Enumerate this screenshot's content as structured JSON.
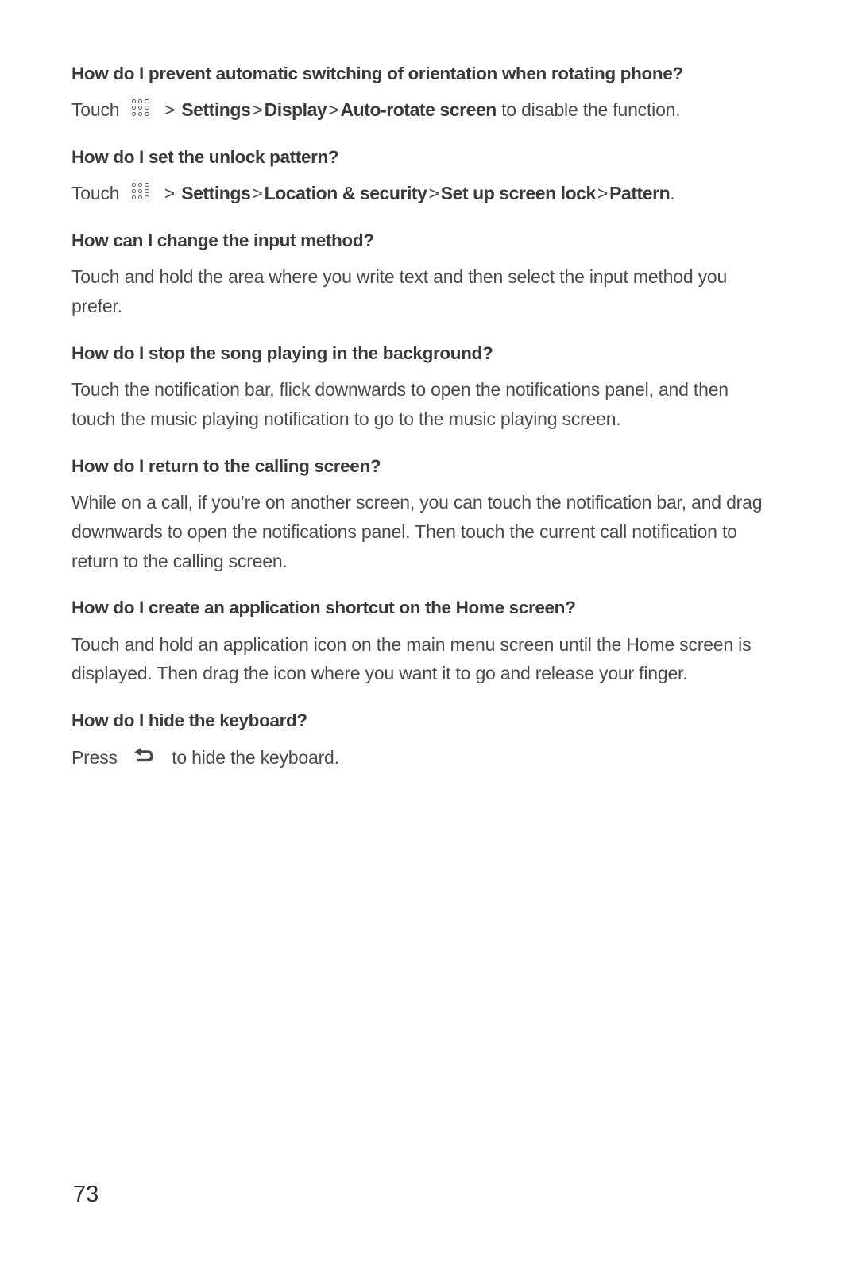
{
  "document": {
    "page_number": "73",
    "icons": {
      "app_grid": "app-grid-icon",
      "back_arrow": "back-arrow-icon"
    }
  },
  "faqs": [
    {
      "question": "How do I prevent automatic switching of orientation when rotating phone?",
      "answer_type": "path",
      "lead": "Touch",
      "icon": "app-grid-icon",
      "steps": [
        "Settings",
        "Display",
        "Auto-rotate screen"
      ],
      "trail": "to disable the function."
    },
    {
      "question": "How do I set the unlock pattern?",
      "answer_type": "path",
      "lead": "Touch",
      "icon": "app-grid-icon",
      "steps": [
        "Settings",
        "Location & security",
        "Set up screen lock",
        "Pattern"
      ],
      "trail": "."
    },
    {
      "question": "How can I change the input method?",
      "answer_type": "text",
      "answer": "Touch and hold the area where you write text and then select the input method you prefer."
    },
    {
      "question": "How do I stop the song playing in the background?",
      "answer_type": "text",
      "answer": "Touch the notification bar, flick downwards to open the notifications panel, and then touch the music playing notification to go to the music playing screen."
    },
    {
      "question": "How do I return to the calling screen?",
      "answer_type": "text",
      "answer": "While on a call, if you’re on another screen, you can touch the notification bar, and drag downwards to open the notifications panel. Then touch the current call notification to return to the calling screen."
    },
    {
      "question": "How do I create an application shortcut on the Home screen?",
      "answer_type": "text",
      "answer": "Touch and hold an application icon on the main menu screen until the Home screen is displayed. Then drag the icon where you want it to go and release your finger."
    },
    {
      "question": "How do I hide the keyboard?",
      "answer_type": "back",
      "lead": "Press",
      "icon": "back-arrow-icon",
      "trail": "to hide the keyboard."
    }
  ],
  "separator": ">",
  "colors": {
    "text": "#4a4a4a",
    "heading": "#3a3a3a",
    "background": "#ffffff"
  }
}
